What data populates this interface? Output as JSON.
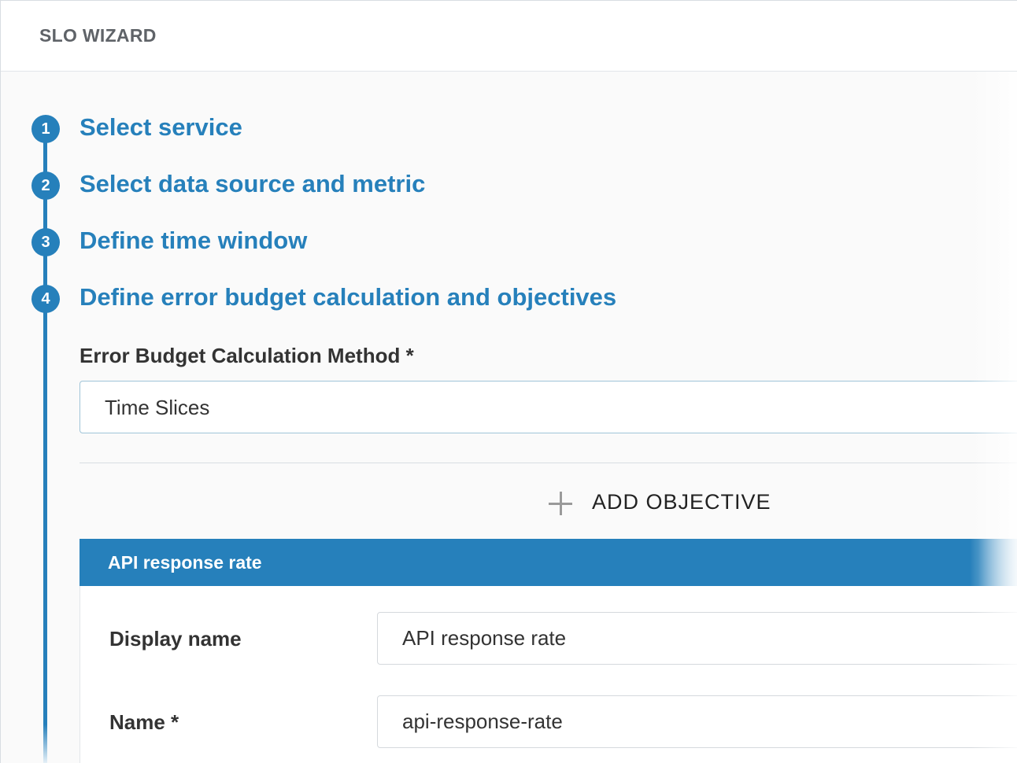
{
  "header": {
    "title": "SLO WIZARD"
  },
  "steps": [
    {
      "number": "1",
      "label": "Select service"
    },
    {
      "number": "2",
      "label": "Select data source and metric"
    },
    {
      "number": "3",
      "label": "Define time window"
    },
    {
      "number": "4",
      "label": "Define error budget calculation and objectives"
    }
  ],
  "error_budget": {
    "label": "Error Budget Calculation Method *",
    "value": "Time Slices"
  },
  "add_objective": {
    "label": "ADD OBJECTIVE",
    "icon": "plus-icon"
  },
  "objective": {
    "title": "API response rate",
    "display_name": {
      "label": "Display name",
      "value": "API response rate"
    },
    "name": {
      "label": "Name *",
      "value": "api-response-rate"
    }
  },
  "colors": {
    "accent": "#2680bb",
    "text": "#333333",
    "header_text": "#5f6368"
  }
}
